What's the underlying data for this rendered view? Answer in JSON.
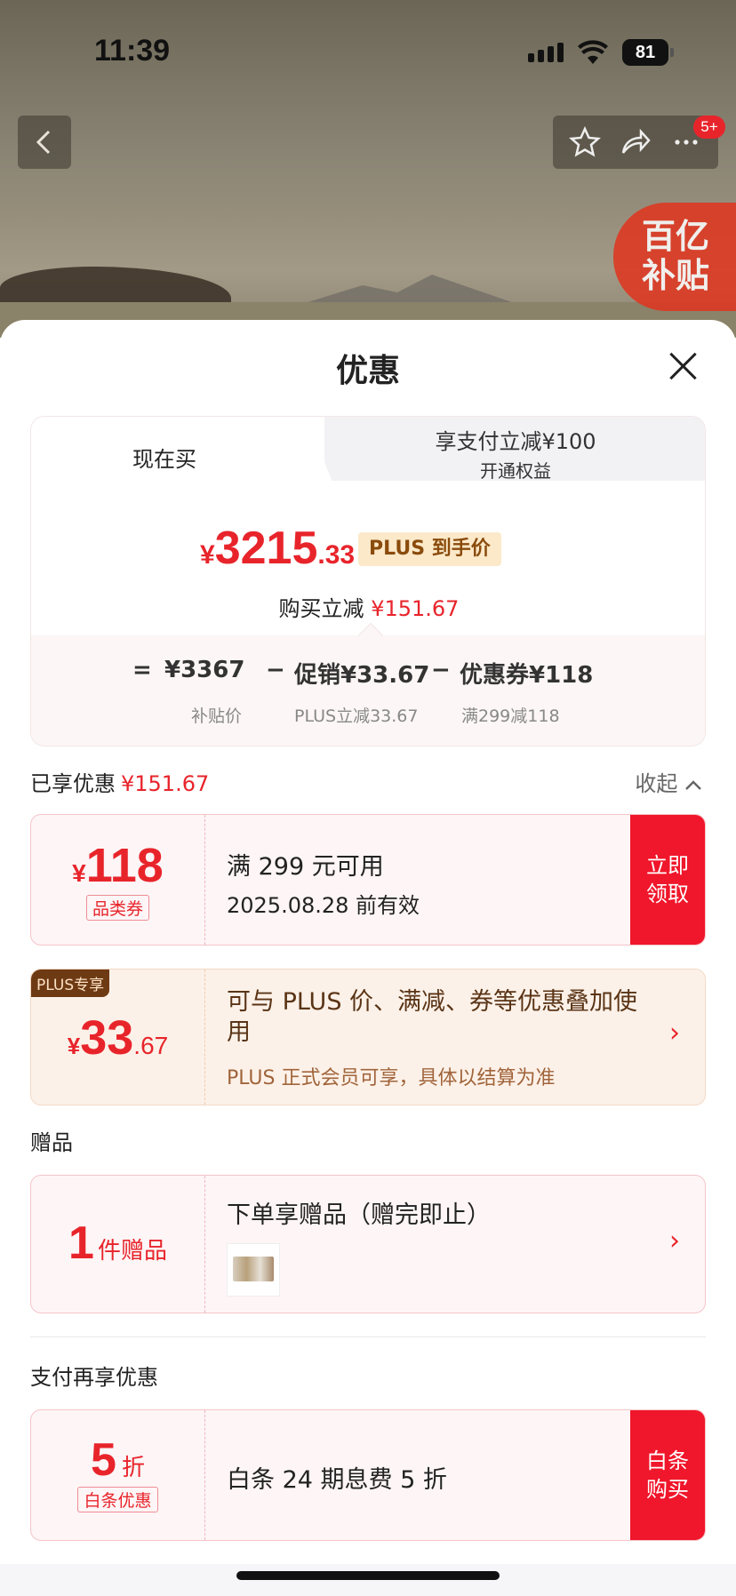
{
  "status_bar": {
    "time": "11:39",
    "battery": "81"
  },
  "top": {
    "badge": "5+",
    "subsidy": [
      "百亿",
      "补贴"
    ]
  },
  "sheet": {
    "title": "优惠"
  },
  "tabs": {
    "now": "现在买",
    "pay_title": "享支付立减¥100",
    "pay_sub": "开通权益"
  },
  "price": {
    "currency": "¥",
    "integer": "3215",
    "decimal": ".33",
    "plus_tag": "PLUS 到手价",
    "reduce_label": "购买立减",
    "reduce_value": "¥151.67"
  },
  "formula": {
    "eq": "=",
    "base": "¥3367",
    "minus": "−",
    "promo": "促销¥33.67",
    "coupon": "优惠券¥118",
    "base_sub": "补贴价",
    "promo_sub": "PLUS立减33.67",
    "coupon_sub": "满299减118"
  },
  "enjoyed": {
    "label": "已享优惠",
    "value": "¥151.67",
    "collapse": "收起"
  },
  "coupon": {
    "currency": "¥",
    "amount": "118",
    "tag": "品类券",
    "line1": "满 299 元可用",
    "line2": "2025.08.28 前有效",
    "button": "立即领取"
  },
  "plus": {
    "badge": "PLUS专享",
    "currency": "¥",
    "integer": "33",
    "decimal": ".67",
    "line1": "可与 PLUS 价、满减、券等优惠叠加使用",
    "line2": "PLUS 正式会员可享，具体以结算为准"
  },
  "gift_section": {
    "label": "赠品",
    "count": "1",
    "unit": "件赠品",
    "title": "下单享赠品（赠完即止）"
  },
  "pay_section": {
    "label": "支付再享优惠",
    "discount": "5",
    "unit": "折",
    "tag": "白条优惠",
    "text": "白条 24 期息费 5 折",
    "button": "白条购买"
  },
  "colors": {
    "accent": "#e8242b",
    "button": "#f0162b"
  }
}
